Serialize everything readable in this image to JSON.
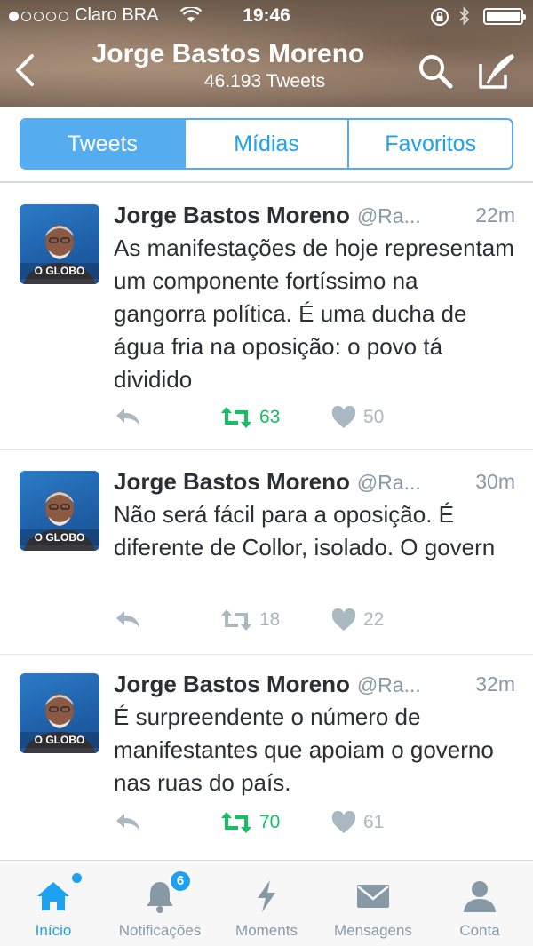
{
  "status_bar": {
    "carrier": "Claro BRA",
    "time": "19:46"
  },
  "header": {
    "name": "Jorge Bastos Moreno",
    "tweet_count": "46.193 Tweets"
  },
  "segments": [
    "Tweets",
    "Mídias",
    "Favoritos"
  ],
  "tweets": [
    {
      "name": "Jorge Bastos Moreno",
      "handle": "@Ra...",
      "time": "22m",
      "avatar_label": "O GLOBO",
      "text": "As manifestações de hoje representam um componente fortíssimo na gangorra política. É uma ducha de água fria na oposição: o povo tá dividido",
      "retweets": "63",
      "likes": "50",
      "retweeted": true
    },
    {
      "name": "Jorge Bastos Moreno",
      "handle": "@Ra...",
      "time": "30m",
      "avatar_label": "O GLOBO",
      "text": "Não será fácil para a oposição. É diferente de Collor, isolado. O govern",
      "retweets": "18",
      "likes": "22",
      "retweeted": false
    },
    {
      "name": "Jorge Bastos Moreno",
      "handle": "@Ra...",
      "time": "32m",
      "avatar_label": "O GLOBO",
      "text": "É surpreendente o número de manifestantes que apoiam o governo nas ruas do país.",
      "retweets": "70",
      "likes": "61",
      "retweeted": true
    }
  ],
  "tabbar": {
    "items": [
      "Início",
      "Notificações",
      "Moments",
      "Mensagens",
      "Conta"
    ],
    "notification_badge": "6"
  },
  "colors": {
    "accent": "#1da1f2",
    "retweet_active": "#17bf63",
    "muted": "#aab8c2"
  }
}
